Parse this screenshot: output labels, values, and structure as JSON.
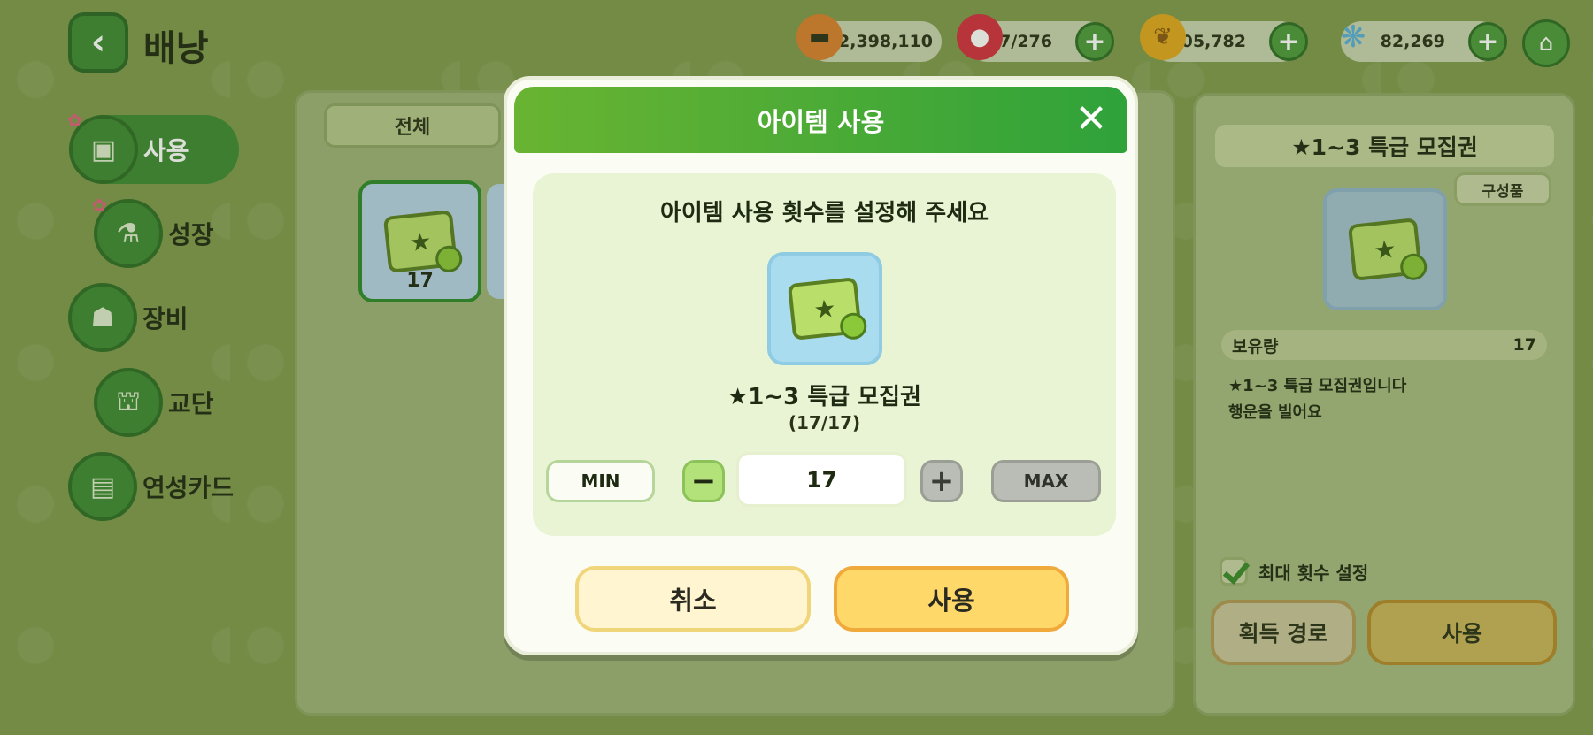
{
  "header": {
    "title": "배낭",
    "currencies": [
      {
        "name": "cookie",
        "value": "2,398,110",
        "has_plus": false
      },
      {
        "name": "gem",
        "value": "117/276",
        "has_plus": true
      },
      {
        "name": "coin",
        "value": "6,105,782",
        "has_plus": true
      },
      {
        "name": "butterfly",
        "value": "82,269",
        "has_plus": true
      }
    ]
  },
  "sidebar": {
    "items": [
      {
        "label": "사용",
        "active": true
      },
      {
        "label": "성장"
      },
      {
        "label": "장비"
      },
      {
        "label": "교단"
      },
      {
        "label": "연성카드"
      }
    ]
  },
  "center": {
    "filter_label": "전체",
    "items": [
      {
        "count": "17"
      }
    ]
  },
  "details": {
    "title": "★1~3 특급 모집권",
    "components_label": "구성품",
    "owned_label": "보유량",
    "owned_value": "17",
    "description_line1": "★1~3 특급 모집권입니다",
    "description_line2": "행운을 빌어요",
    "max_count_label": "최대 횟수 설정",
    "source_button": "획득 경로",
    "use_button": "사용"
  },
  "modal": {
    "title": "아이템 사용",
    "prompt": "아이템 사용 횟수를 설정해 주세요",
    "item_name": "★1~3 특급 모집권",
    "item_count": "(17/17)",
    "min_label": "MIN",
    "max_label": "MAX",
    "quantity": "17",
    "cancel_label": "취소",
    "use_label": "사용"
  }
}
